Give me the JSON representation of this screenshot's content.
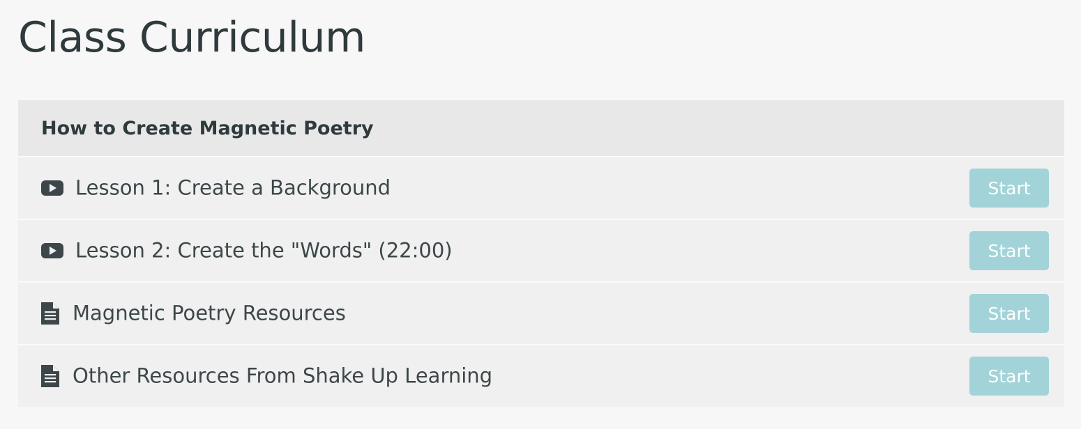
{
  "page": {
    "title": "Class Curriculum"
  },
  "section": {
    "title": "How to Create Magnetic Poetry",
    "items": [
      {
        "icon": "video-play-icon",
        "label": "Lesson 1: Create a Background",
        "button": "Start"
      },
      {
        "icon": "video-play-icon",
        "label": "Lesson 2: Create the \"Words\" (22:00)",
        "button": "Start"
      },
      {
        "icon": "document-icon",
        "label": "Magnetic Poetry Resources",
        "button": "Start"
      },
      {
        "icon": "document-icon",
        "label": "Other Resources From Shake Up Learning",
        "button": "Start"
      }
    ]
  },
  "colors": {
    "page_background": "#f7f7f7",
    "section_header_background": "#e8e8e8",
    "row_background": "#f0f0f0",
    "start_button_background": "#a2d3d8",
    "text_dark": "#2f3a3c",
    "icon_color": "#3d4749"
  }
}
